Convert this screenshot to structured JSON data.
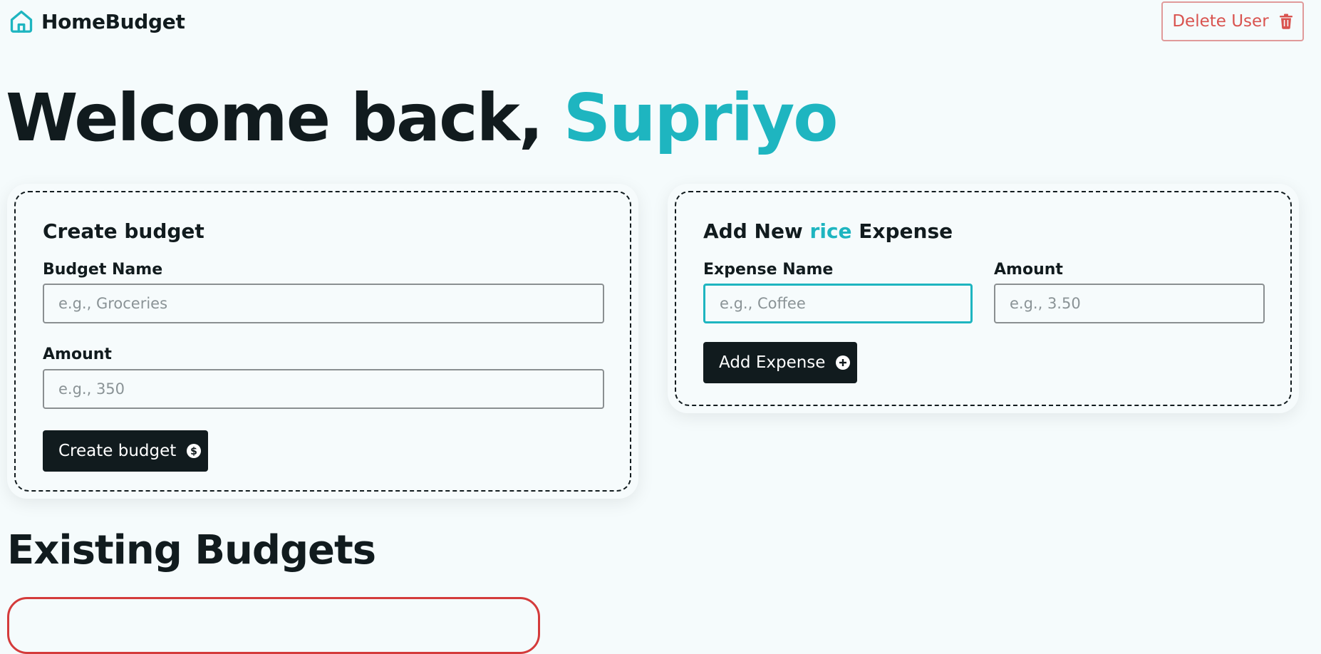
{
  "nav": {
    "brand": "HomeBudget",
    "delete_label": "Delete User"
  },
  "welcome": {
    "prefix": "Welcome back, ",
    "name": "Supriyo"
  },
  "create_budget": {
    "title": "Create budget",
    "name_label": "Budget Name",
    "name_placeholder": "e.g., Groceries",
    "name_value": "",
    "amount_label": "Amount",
    "amount_placeholder": "e.g., 350",
    "amount_value": "",
    "button_label": "Create budget",
    "button_icon": "currency-dollar-circle-icon"
  },
  "add_expense": {
    "title_prefix": "Add New ",
    "title_budget": "rice",
    "title_suffix": " Expense",
    "name_label": "Expense Name",
    "name_placeholder": "e.g., Coffee",
    "name_value": "",
    "amount_label": "Amount",
    "amount_placeholder": "e.g., 3.50",
    "amount_value": "",
    "button_label": "Add Expense",
    "button_icon": "plus-circle-icon"
  },
  "existing": {
    "title": "Existing Budgets"
  },
  "colors": {
    "accent": "#1eb5c0",
    "dark": "#111b1e",
    "danger": "#d9534f",
    "background": "#f5fbfc"
  }
}
